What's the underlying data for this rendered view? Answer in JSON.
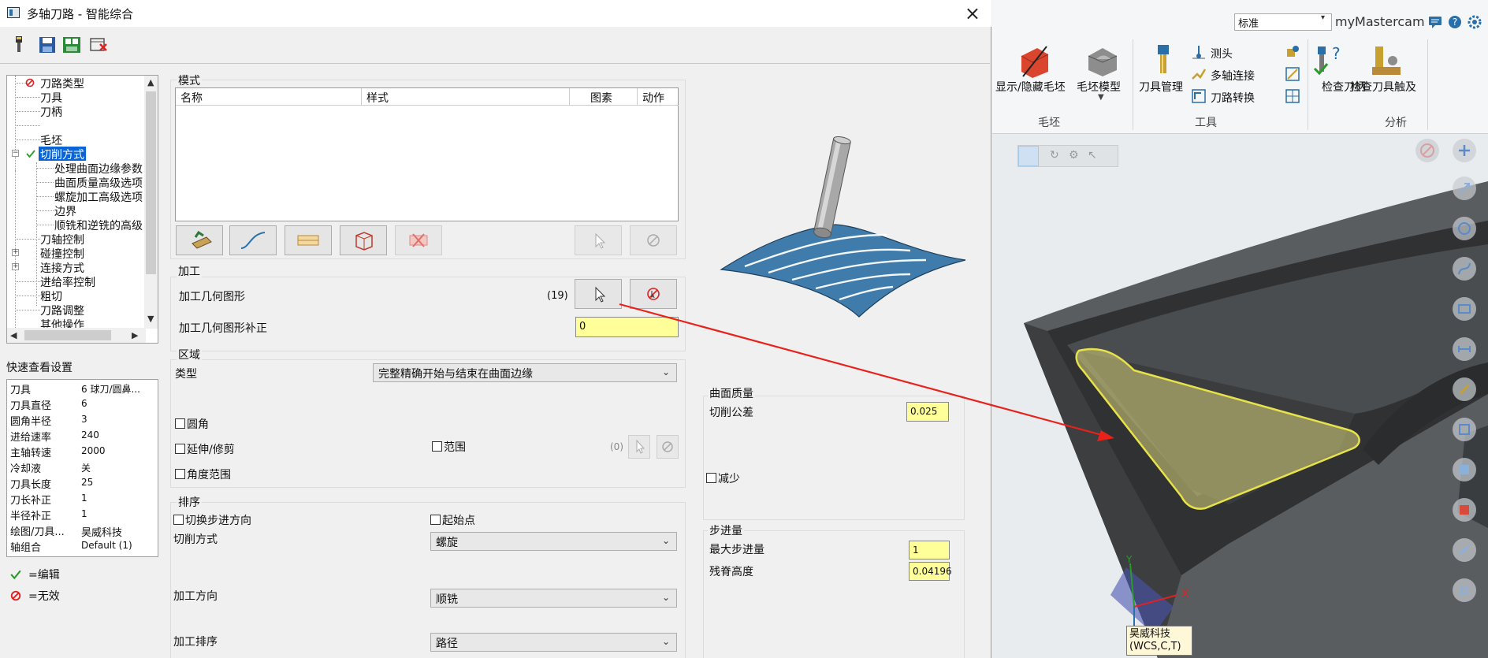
{
  "window": {
    "title": "多轴刀路 - 智能综合",
    "close": "×"
  },
  "toolbar": {
    "icons": [
      "tool-icon",
      "save-icon",
      "save-all-icon",
      "delete-icon"
    ]
  },
  "tree": {
    "items": [
      {
        "label": "刀路类型",
        "icon": "invalid"
      },
      {
        "label": "刀具"
      },
      {
        "label": "刀柄"
      },
      {
        "label": ""
      },
      {
        "label": "毛坯"
      },
      {
        "label": "切削方式",
        "icon": "edited",
        "selected": true
      },
      {
        "label": "处理曲面边缘参数"
      },
      {
        "label": "曲面质量高级选项"
      },
      {
        "label": "螺旋加工高级选项"
      },
      {
        "label": "边界"
      },
      {
        "label": "顺铣和逆铣的高级"
      },
      {
        "label": "刀轴控制"
      },
      {
        "label": "碰撞控制"
      },
      {
        "label": "连接方式"
      },
      {
        "label": "进给率控制"
      },
      {
        "label": "粗切"
      },
      {
        "label": "刀路调整"
      },
      {
        "label": "其他操作"
      }
    ]
  },
  "quick_settings": {
    "title": "快速查看设置",
    "rows": [
      {
        "k": "刀具",
        "v": "6 球刀/圆鼻..."
      },
      {
        "k": "刀具直径",
        "v": "6"
      },
      {
        "k": "圆角半径",
        "v": "3"
      },
      {
        "k": "进给速率",
        "v": "240"
      },
      {
        "k": "主轴转速",
        "v": "2000"
      },
      {
        "k": "冷却液",
        "v": "关"
      },
      {
        "k": "刀具长度",
        "v": "25"
      },
      {
        "k": "刀长补正",
        "v": "1"
      },
      {
        "k": "半径补正",
        "v": "1"
      },
      {
        "k": "绘图/刀具...",
        "v": "昊威科技"
      },
      {
        "k": "轴组合",
        "v": "Default (1)"
      }
    ],
    "legend_edit": "=编辑",
    "legend_invalid": "=无效"
  },
  "mode": {
    "title": "模式",
    "columns": [
      "名称",
      "样式",
      "图素",
      "动作"
    ]
  },
  "machining": {
    "title": "加工",
    "geometry_label": "加工几何图形",
    "geometry_count": "(19)",
    "offset_label": "加工几何图形补正",
    "offset_value": "0"
  },
  "region": {
    "title": "区域",
    "type_label": "类型",
    "type_value": "完整精确开始与结束在曲面边缘",
    "fillet": "圆角",
    "extend_trim": "延伸/修剪",
    "range": "范围",
    "range_count": "(0)",
    "angle_range": "角度范围"
  },
  "sorting": {
    "title": "排序",
    "switch_step": "切换步进方向",
    "start_point": "起始点",
    "cut_method_label": "切削方式",
    "cut_method_value": "螺旋",
    "direction_label": "加工方向",
    "direction_value": "顺铣",
    "order_label": "加工排序",
    "order_value": "路径"
  },
  "surface_quality": {
    "title": "曲面质量",
    "tolerance_label": "切削公差",
    "tolerance_value": "0.025",
    "reduce": "减少"
  },
  "stepover": {
    "title": "步进量",
    "max_label": "最大步进量",
    "max_value": "1",
    "scallop_label": "残脊高度",
    "scallop_value": "0.04196"
  },
  "ribbon": {
    "dropdown": "标准",
    "brand": "myMastercam",
    "stock_group": "毛坯",
    "tools_group": "工具",
    "analysis_group": "分析",
    "show_hide_stock": "显示/隐藏毛坯",
    "stock_model": "毛坯模型",
    "tool_manager": "刀具管理",
    "probe": "测头",
    "multiaxis_link": "多轴连接",
    "toolpath_transform": "刀路转换",
    "check_holder": "检查刀柄",
    "check_tool_reach": "检查刀具触及"
  },
  "viewport": {
    "origin_label": "昊威科技",
    "origin_sub": "(WCS,C,T)"
  },
  "colors": {
    "selected": "#0a64d6",
    "yellow_input": "#ffff99",
    "annotation_arrow": "#e8221b",
    "highlight": "#e8e24a"
  }
}
